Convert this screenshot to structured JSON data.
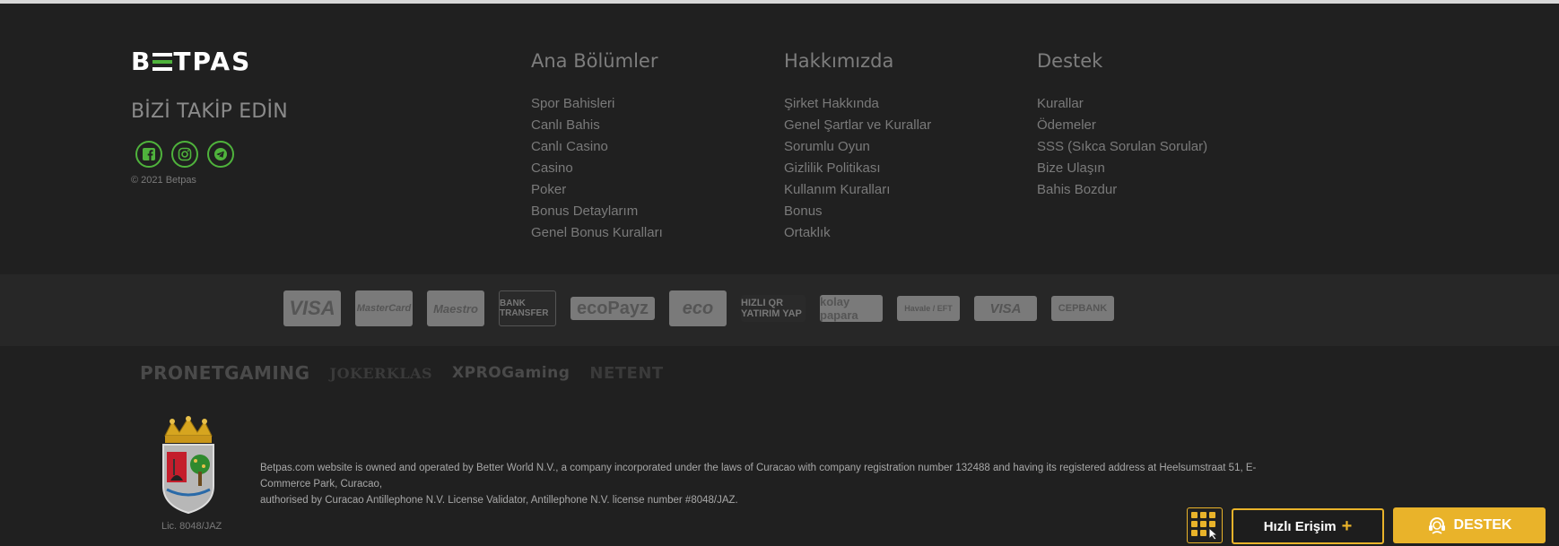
{
  "brand": {
    "logo_text_left": "B",
    "logo_text_right": "TPAS",
    "accent": "#4fb33c",
    "cta": "#e9b32a"
  },
  "follow": {
    "title": "BİZİ TAKİP EDİN",
    "icons": [
      "facebook-icon",
      "instagram-icon",
      "telegram-icon"
    ],
    "copyright": "© 2021 Betpas"
  },
  "columns": [
    {
      "title": "Ana Bölümler",
      "items": [
        "Spor Bahisleri",
        "Canlı Bahis",
        "Canlı Casino",
        "Casino",
        "Poker",
        "Bonus Detaylarım",
        "Genel Bonus Kuralları"
      ]
    },
    {
      "title": "Hakkımızda",
      "items": [
        "Şirket Hakkında",
        "Genel Şartlar ve Kurallar",
        "Sorumlu Oyun",
        "Gizlilik Politikası",
        "Kullanım Kuralları",
        "Bonus",
        "Ortaklık"
      ]
    },
    {
      "title": "Destek",
      "items": [
        "Kurallar",
        "Ödemeler",
        "SSS (Sıkca Sorulan Sorular)",
        "Bize Ulaşın",
        "Bahis Bozdur"
      ]
    }
  ],
  "payments": [
    "VISA",
    "MasterCard",
    "Maestro",
    "BANK TRANSFER",
    "ecoPayz",
    "eco",
    "HIZLI QR YATIRIM YAP",
    "kolay papara",
    "Havale / EFT",
    "VISA",
    "CEPBANK"
  ],
  "providers": [
    "PRONETGAMING",
    "JOKERKLAS",
    "XPROGaming",
    "NETENT"
  ],
  "license": {
    "lic_text": "Lic. 8048/JAZ",
    "legal_line1": "Betpas.com website is owned and operated by Better World N.V., a company incorporated under the laws of Curacao with company registration number 132488 and having its registered address at Heelsumstraat 51, E-Commerce Park, Curacao,",
    "legal_line2": "authorised by Curacao Antillephone N.V. License Validator, Antillephone N.V. license number #8048/JAZ."
  },
  "actions": {
    "quick_access_label": "Hızlı Erişim",
    "support_label": "DESTEK"
  }
}
